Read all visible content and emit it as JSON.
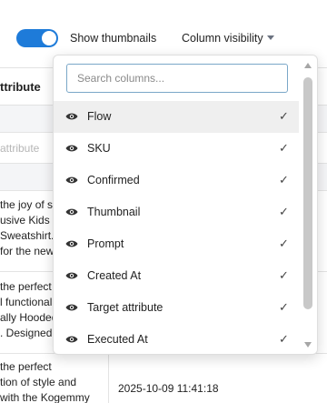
{
  "toolbar": {
    "thumbnails_toggle_on": true,
    "thumbnails_label": "Show thumbnails",
    "column_visibility_label": "Column visibility",
    "accent_color": "#1e7bd9"
  },
  "table": {
    "header_attribute": "ttribute",
    "filter_placeholder": "attribute",
    "rows": [
      {
        "lines": [
          "the joy of s",
          "usive Kids O",
          "Sweatshirt. F",
          "for the new"
        ]
      },
      {
        "lines": [
          "the perfect",
          "l functionali",
          "ally Hooded",
          ". Designed"
        ]
      },
      {
        "lines": [
          "the perfect",
          "tion of style and",
          "with the Kogemmy"
        ],
        "date": "2025-10-09 11:41:18"
      }
    ]
  },
  "dropdown": {
    "search_placeholder": "Search columns...",
    "items": [
      {
        "label": "Flow",
        "visible": true,
        "icon": "eye-icon",
        "check": "✓"
      },
      {
        "label": "SKU",
        "visible": true,
        "icon": "eye-icon",
        "check": "✓"
      },
      {
        "label": "Confirmed",
        "visible": true,
        "icon": "eye-icon",
        "check": "✓"
      },
      {
        "label": "Thumbnail",
        "visible": true,
        "icon": "eye-icon",
        "check": "✓"
      },
      {
        "label": "Prompt",
        "visible": true,
        "icon": "eye-icon",
        "check": "✓"
      },
      {
        "label": "Created At",
        "visible": true,
        "icon": "eye-icon",
        "check": "✓"
      },
      {
        "label": "Target attribute",
        "visible": true,
        "icon": "eye-icon",
        "check": "✓"
      },
      {
        "label": "Executed At",
        "visible": true,
        "icon": "eye-icon",
        "check": "✓"
      }
    ]
  }
}
